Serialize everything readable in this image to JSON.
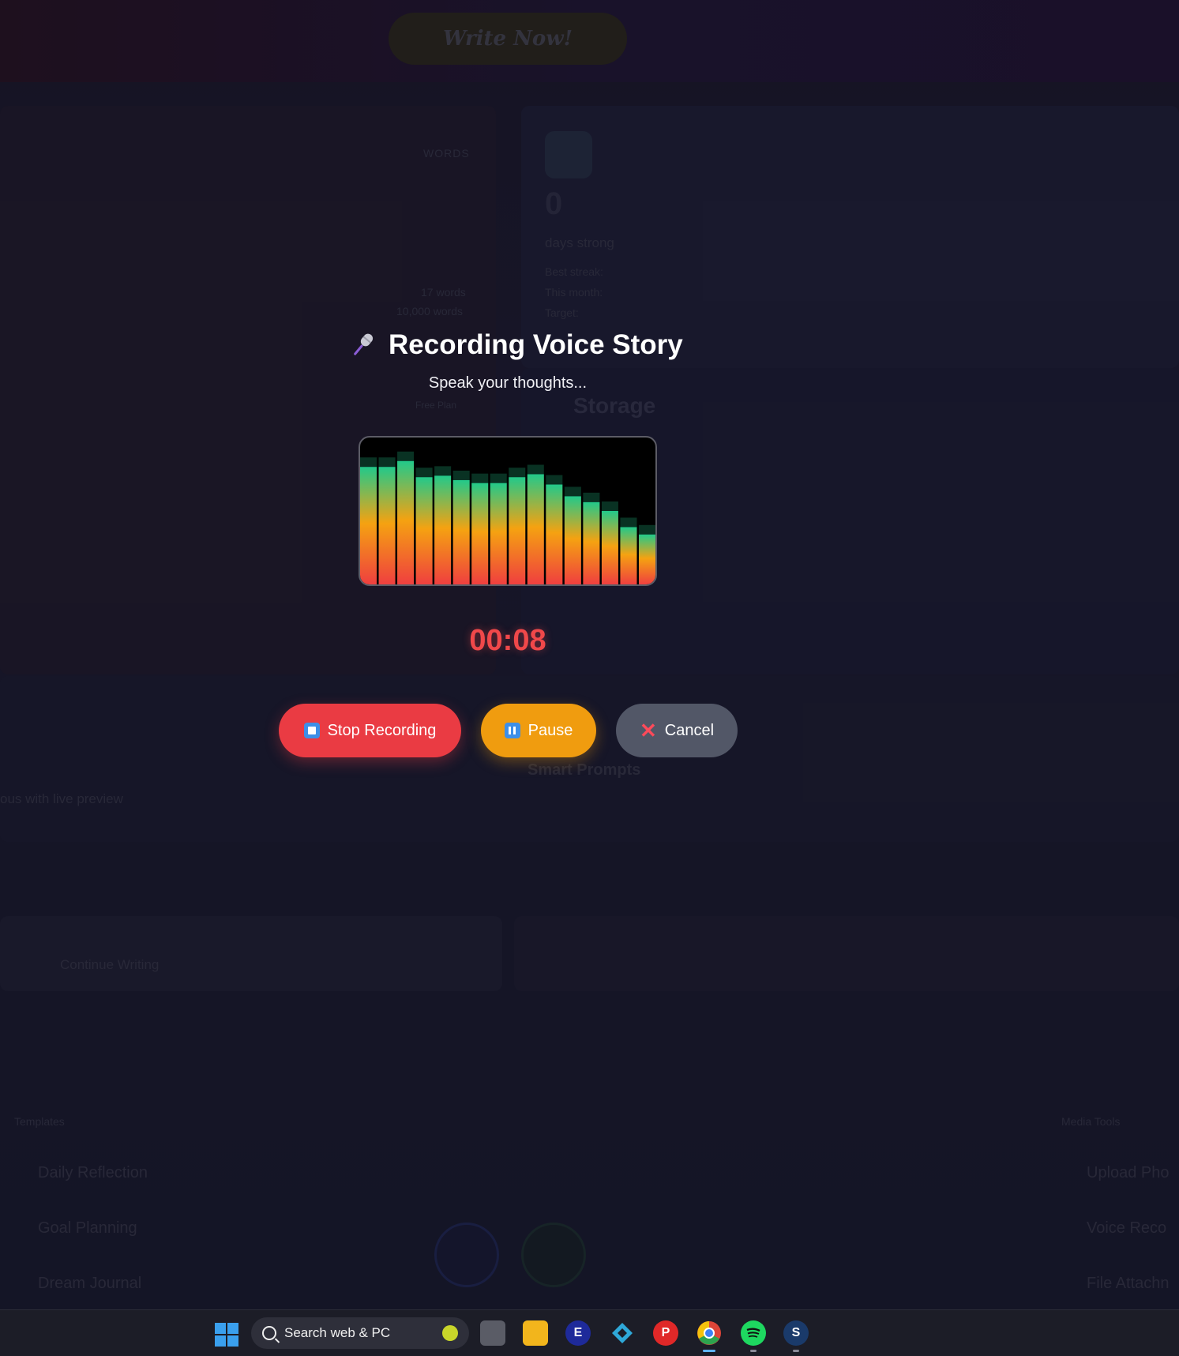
{
  "background": {
    "write_now_label": "Write Now!",
    "words_label": "WORDS",
    "streak_value": "0",
    "streak_caption": "days strong",
    "best_streak_label": "Best streak:",
    "this_month_label": "This month:",
    "target_label": "Target:",
    "words_count": "17 words",
    "goal_words": "10,000 words",
    "free_plan": "Free Plan",
    "storage_title": "Storage",
    "smart_prompts_title": "Smart Prompts",
    "live_preview_text": "ous with live preview",
    "continue_writing": "Continue Writing",
    "templates_label": "Templates",
    "media_tools_label": "Media Tools",
    "templates": [
      "Daily Reflection",
      "Goal Planning",
      "Dream Journal"
    ],
    "media_tools": [
      "Upload Pho",
      "Voice Reco",
      "File Attachn"
    ]
  },
  "modal": {
    "title": "Recording Voice Story",
    "icon": "microphone-icon",
    "subtitle": "Speak your thoughts...",
    "timer": "00:08",
    "levels": [
      0.8,
      0.8,
      0.84,
      0.73,
      0.74,
      0.71,
      0.69,
      0.69,
      0.73,
      0.75,
      0.68,
      0.6,
      0.56,
      0.5,
      0.39,
      0.34
    ],
    "buttons": {
      "stop": "Stop Recording",
      "pause": "Pause",
      "cancel": "Cancel"
    },
    "colors": {
      "stop": "#ea3b43",
      "pause": "#f09c0f",
      "cancel": "#525767",
      "timer": "#f0484a",
      "bar_top": "#22c98a",
      "bar_mid": "#f5a211",
      "bar_bottom": "#ef3f3f"
    }
  },
  "taskbar": {
    "search_placeholder": "Search web & PC",
    "apps": [
      "start-icon",
      "task-view-icon",
      "file-explorer-icon",
      "everything-icon",
      "kodi-icon",
      "pinterest-icon",
      "chrome-icon",
      "spotify-icon",
      "steam-icon"
    ]
  }
}
